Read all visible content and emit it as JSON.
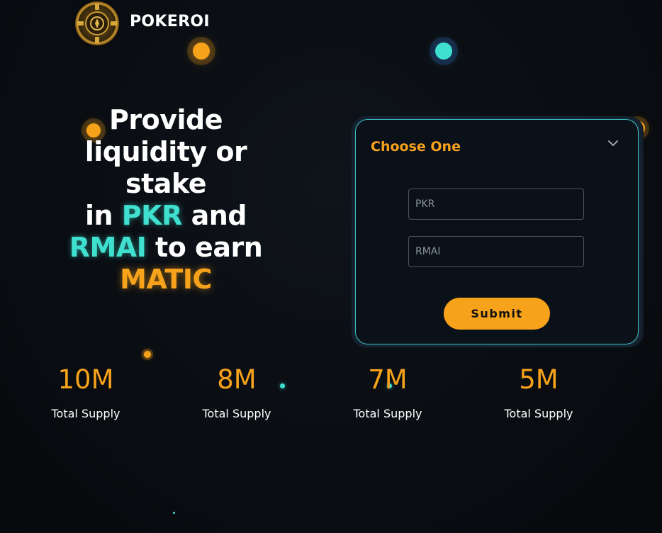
{
  "header": {
    "brand": "POKEROI",
    "logo_icon": "poker-chip-logo"
  },
  "hero": {
    "line1": "Provide",
    "line2": "liquidity or",
    "line3": "stake",
    "line4_prefix": "in ",
    "line4_token": "PKR",
    "line4_suffix": " and",
    "line5_token": "RMAI",
    "line5_suffix": " to earn",
    "line6_token": "MATIC"
  },
  "form": {
    "dropdown_label": "Choose One",
    "dropdown_icon": "chevron-down-icon",
    "pkr_placeholder": "PKR",
    "rmai_placeholder": "RMAI",
    "submit_label": "Submit"
  },
  "stats": [
    {
      "value": "10M",
      "label": "Total Supply"
    },
    {
      "value": "8M",
      "label": "Total Supply"
    },
    {
      "value": "7M",
      "label": "Total Supply"
    },
    {
      "value": "5M",
      "label": "Total Supply"
    }
  ],
  "colors": {
    "accent_orange": "#f7a21b",
    "accent_teal": "#3fe0d0",
    "background": "#0a0d12",
    "card_border": "#3ec2c6"
  }
}
